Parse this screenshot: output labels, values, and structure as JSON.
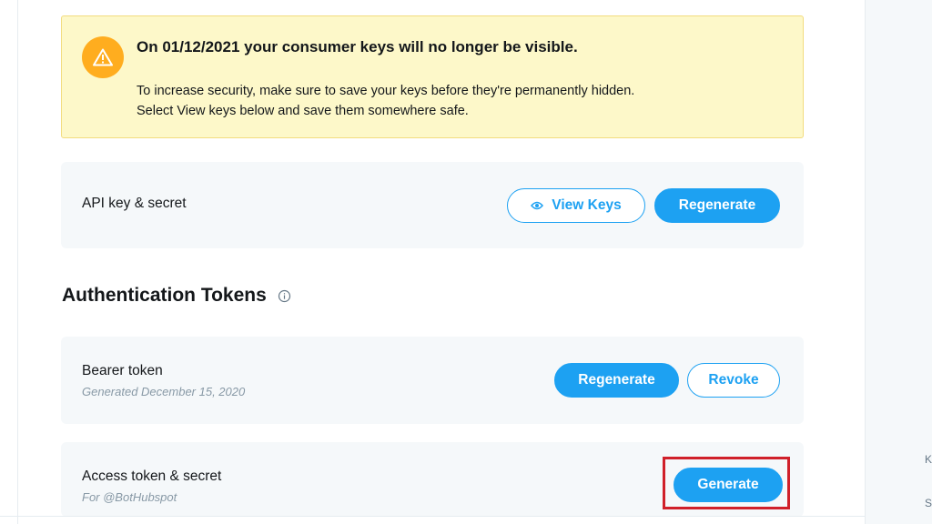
{
  "alert": {
    "title": "On 01/12/2021 your consumer keys will no longer be visible.",
    "body_line1": "To increase security, make sure to save your keys before they're permanently hidden.",
    "body_line2": "Select View keys below and save them somewhere safe.",
    "icon": "warning-icon"
  },
  "api_keys": {
    "title": "API key & secret",
    "view_keys_label": "View Keys",
    "view_keys_icon": "eye-icon",
    "regenerate_label": "Regenerate"
  },
  "auth_tokens": {
    "heading": "Authentication Tokens",
    "heading_icon": "info-icon",
    "bearer": {
      "title": "Bearer token",
      "subtitle": "Generated December 15, 2020",
      "regenerate_label": "Regenerate",
      "revoke_label": "Revoke"
    },
    "access": {
      "title": "Access token & secret",
      "subtitle": "For @BotHubspot",
      "generate_label": "Generate"
    }
  },
  "right_panel": {
    "fragment1": "K",
    "fragment2": "S"
  },
  "colors": {
    "accent": "#1da1f2",
    "alert_bg": "#fdf8c9",
    "alert_border": "#f2dc7f",
    "warning_icon": "#ffad1f",
    "card_bg": "#f5f8fa",
    "highlight": "#d0202a"
  }
}
